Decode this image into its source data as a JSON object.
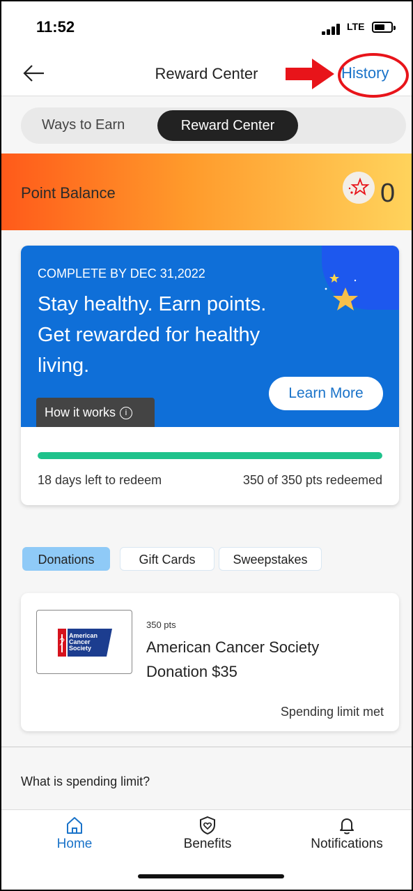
{
  "status_bar": {
    "time": "11:52",
    "network": "LTE"
  },
  "nav": {
    "title": "Reward Center",
    "history_label": "History"
  },
  "segmented": {
    "options": [
      "Ways to Earn",
      "Reward Center"
    ],
    "selected": "Reward Center"
  },
  "balance": {
    "label": "Point Balance",
    "value": "0"
  },
  "promo": {
    "kicker": "COMPLETE BY DEC 31,2022",
    "headline": "Stay healthy. Earn points. Get rewarded for healthy living.",
    "how_it_works": "How it works",
    "learn_more": "Learn More",
    "progress_fraction": 1.0,
    "days_left": "18 days left to redeem",
    "redeemed": "350 of 350 pts redeemed",
    "colors": {
      "background": "#0f6fd8",
      "progress": "#1ec28b"
    }
  },
  "filters": {
    "chips": [
      "Donations",
      "Gift Cards",
      "Sweepstakes"
    ],
    "active": "Donations"
  },
  "reward": {
    "points": "350 pts",
    "name": "American Cancer Society Donation $35",
    "status": "Spending limit met",
    "logo_text": "American Cancer Society"
  },
  "footer_link": "What is spending limit?",
  "tabs": [
    {
      "label": "Home",
      "icon": "home-icon",
      "active": true
    },
    {
      "label": "Benefits",
      "icon": "shield-heart-icon",
      "active": false
    },
    {
      "label": "Notifications",
      "icon": "bell-icon",
      "active": false
    }
  ],
  "annotation_color": "#e8141a"
}
